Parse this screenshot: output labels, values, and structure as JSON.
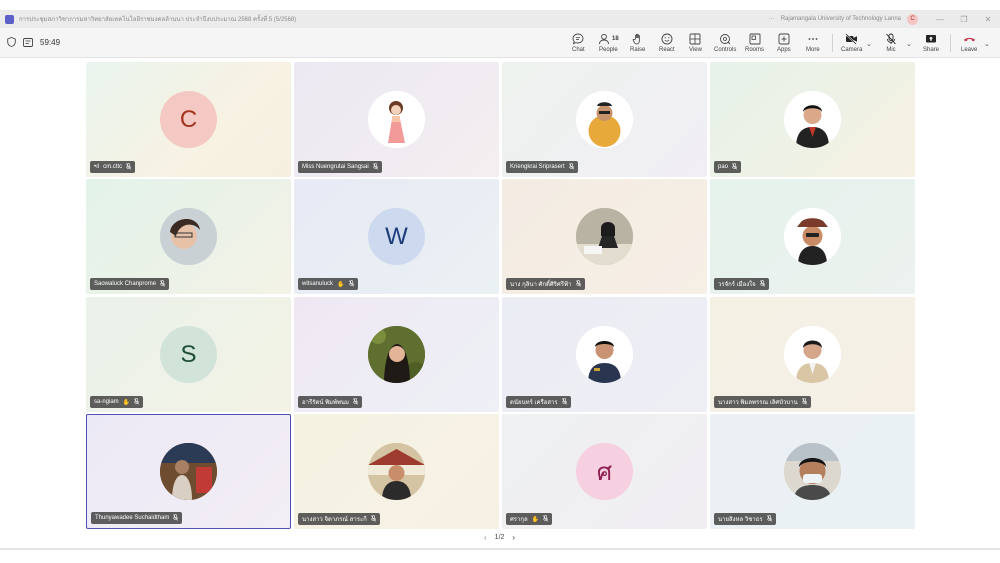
{
  "titlebar": {
    "meeting_title": "การประชุมสภาวิชาการมหาวิทยาลัยเทคโนโลยีราชมงคลล้านนา ประจำปีงบประมาณ 2568 ครั้งที่ 5 (5/2568)",
    "org_name": "Rajamangala University of Technology Lanna",
    "more_label": "···",
    "user_initial": "C",
    "minimize": "—",
    "restore": "❐",
    "close": "✕"
  },
  "toolbar": {
    "timer": "59:49",
    "chat_label": "Chat",
    "people_label": "People",
    "people_count": "18",
    "raise_label": "Raise",
    "react_label": "React",
    "view_label": "View",
    "controls_label": "Controls",
    "rooms_label": "Rooms",
    "apps_label": "Apps",
    "more_label": "More",
    "camera_label": "Camera",
    "mic_label": "Mic",
    "share_label": "Share",
    "leave_label": "Leave"
  },
  "participants": [
    {
      "name": "cm.cttc",
      "initial": "C",
      "signal": "•ıl",
      "avatar_bg": "#f4c9c3",
      "avatar_fg": "#a3331f",
      "tile_bg": "linear-gradient(135deg,#e9f4ee 0%,#f7f2e3 60%,#f6efe0 100%)",
      "type": "initial"
    },
    {
      "name": "Miss Nuengrutai Sangsai",
      "initial": "",
      "avatar_bg": "#ffffff",
      "tile_bg": "linear-gradient(135deg,#ece9f3 0%,#f4eef0 100%)",
      "type": "photo",
      "photo": "girl"
    },
    {
      "name": "Kriengkrai Sriprasert",
      "initial": "",
      "avatar_bg": "#ffffff",
      "tile_bg": "linear-gradient(135deg,#edf2ee 0%,#f1eef4 100%)",
      "type": "photo",
      "photo": "man-glasses"
    },
    {
      "name": "pao",
      "initial": "",
      "avatar_bg": "#ffffff",
      "tile_bg": "linear-gradient(135deg,#e6f2ea 0%,#f6f1e2 100%)",
      "type": "photo",
      "photo": "man-suit"
    },
    {
      "name": "Saowaluck Chanprome",
      "initial": "",
      "avatar_bg": "#d8dde0",
      "tile_bg": "linear-gradient(135deg,#e3f3ea 0%,#f3f2e6 100%)",
      "type": "photo",
      "photo": "woman-selfie"
    },
    {
      "name": "witsanuluck",
      "initial": "W",
      "hand": "✋",
      "avatar_bg": "#cdd9ee",
      "avatar_fg": "#1c3d7a",
      "tile_bg": "linear-gradient(135deg,#e8eaf5 0%,#eaf1f3 100%)",
      "type": "initial"
    },
    {
      "name": "นาง กุลินา ศักดิ์ศิริศรีฟ้า",
      "initial": "",
      "avatar_bg": "#c9c2b0",
      "tile_bg": "linear-gradient(135deg,#f4ece3 0%,#f6efe6 100%)",
      "type": "photo",
      "photo": "woman-desk"
    },
    {
      "name": "วรจักร์ เมืองใจ",
      "initial": "",
      "avatar_bg": "#ffffff",
      "tile_bg": "linear-gradient(135deg,#e6f2ec 0%,#ecf2ef 100%)",
      "type": "photo",
      "photo": "man-hat"
    },
    {
      "name": "sa-ngiam",
      "initial": "S",
      "hand": "✋",
      "avatar_bg": "#d2e4da",
      "avatar_fg": "#1f4d33",
      "tile_bg": "linear-gradient(135deg,#eaf2ea 0%,#f3f2e5 100%)",
      "type": "initial"
    },
    {
      "name": "อารีรัตน์ พิมพ์พนม",
      "initial": "",
      "avatar_bg": "#6a7a3a",
      "tile_bg": "linear-gradient(135deg,#efe8f3 0%,#eef0f6 100%)",
      "type": "photo",
      "photo": "woman-leaves"
    },
    {
      "name": "ดนัยนทร์ เครือสาร",
      "initial": "",
      "avatar_bg": "#ffffff",
      "tile_bg": "linear-gradient(135deg,#ebedf4 0%,#eeeef5 100%)",
      "type": "photo",
      "photo": "man-uniform"
    },
    {
      "name": "นางสาว พิมลพรรณ เลิศบัวบาน",
      "initial": "",
      "avatar_bg": "#ffffff",
      "tile_bg": "linear-gradient(135deg,#f4f1e4 0%,#f5efe6 100%)",
      "type": "photo",
      "photo": "man-beige"
    },
    {
      "name": "Thunyawadee Suchaidtham",
      "initial": "",
      "avatar_bg": "#7a5a3a",
      "tile_bg": "linear-gradient(135deg,#ece9f6 0%,#f3eef5 100%)",
      "type": "photo",
      "photo": "woman-market",
      "active": true
    },
    {
      "name": "นางสาว จิดาภรณ์ สาระกี",
      "initial": "",
      "avatar_bg": "#c9b99a",
      "tile_bg": "linear-gradient(135deg,#f5f2e2 0%,#f7f1e5 100%)",
      "type": "photo",
      "photo": "man-temple"
    },
    {
      "name": "ศรากุล",
      "initial": "ศ",
      "hand": "✋",
      "avatar_bg": "#f6cfe0",
      "avatar_fg": "#8c1d4f",
      "tile_bg": "linear-gradient(135deg,#eef0f2 0%,#f1eef2 100%)",
      "type": "initial"
    },
    {
      "name": "นายสิงหล วิชาธร",
      "initial": "",
      "avatar_bg": "#d9d4cc",
      "tile_bg": "linear-gradient(135deg,#ebf0f5 0%,#e9f1f2 100%)",
      "type": "photo",
      "photo": "man-mask"
    }
  ],
  "pager": {
    "prev": "‹",
    "label": "1/2",
    "next": "›"
  }
}
